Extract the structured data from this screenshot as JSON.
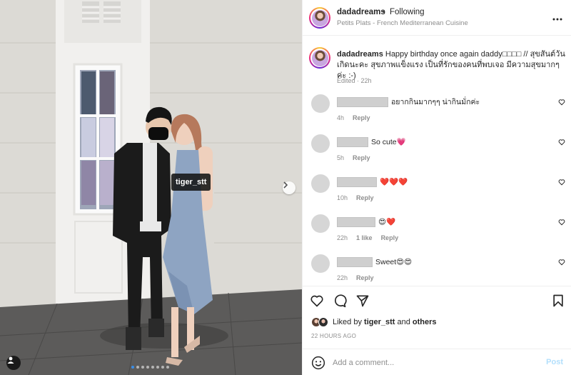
{
  "post": {
    "username": "dadadreams",
    "follow_status": "Following",
    "separator": "•",
    "location": "Petits Plats - French Mediterranean Cuisine",
    "more_icon": "more-horizontal-icon",
    "caption_username": "dadadreams",
    "caption_text": "Happy birthday once again daddy□□□□ // สุขสันต์วันเกิดนะคะ สุขภาพแข็งแรง เป็นที่รักของคนที่พบเจอ มีความสุขมากๆค่ะ :-)",
    "caption_meta": "Edited · 22h"
  },
  "photo": {
    "tag_label": "tiger_stt",
    "slide_count": 8,
    "active_slide": 0
  },
  "comments": [
    {
      "text": "อยากกินมากๆๆ น่ากินมั่กค่ะ",
      "time": "4h",
      "likes": "",
      "reply": "Reply",
      "name_width": 72
    },
    {
      "text": "So cute💗",
      "time": "5h",
      "likes": "",
      "reply": "Reply",
      "name_width": 44
    },
    {
      "text": "❤️❤️❤️",
      "time": "10h",
      "likes": "",
      "reply": "Reply",
      "name_width": 56
    },
    {
      "text": "😍❤️",
      "time": "22h",
      "likes": "1 like",
      "reply": "Reply",
      "name_width": 54
    },
    {
      "text": "Sweet😍😍",
      "time": "22h",
      "likes": "",
      "reply": "Reply",
      "name_width": 50
    }
  ],
  "likes": {
    "prefix": "Liked by ",
    "user": "tiger_stt",
    "middle": " and ",
    "others": "others"
  },
  "time_ago": "22 HOURS AGO",
  "comment_box": {
    "placeholder": "Add a comment...",
    "post_label": "Post"
  },
  "colors": {
    "border": "#efefef",
    "muted": "#8e8e8e",
    "post_disabled": "#b2dffc",
    "dot_active": "#3a8ee6"
  }
}
